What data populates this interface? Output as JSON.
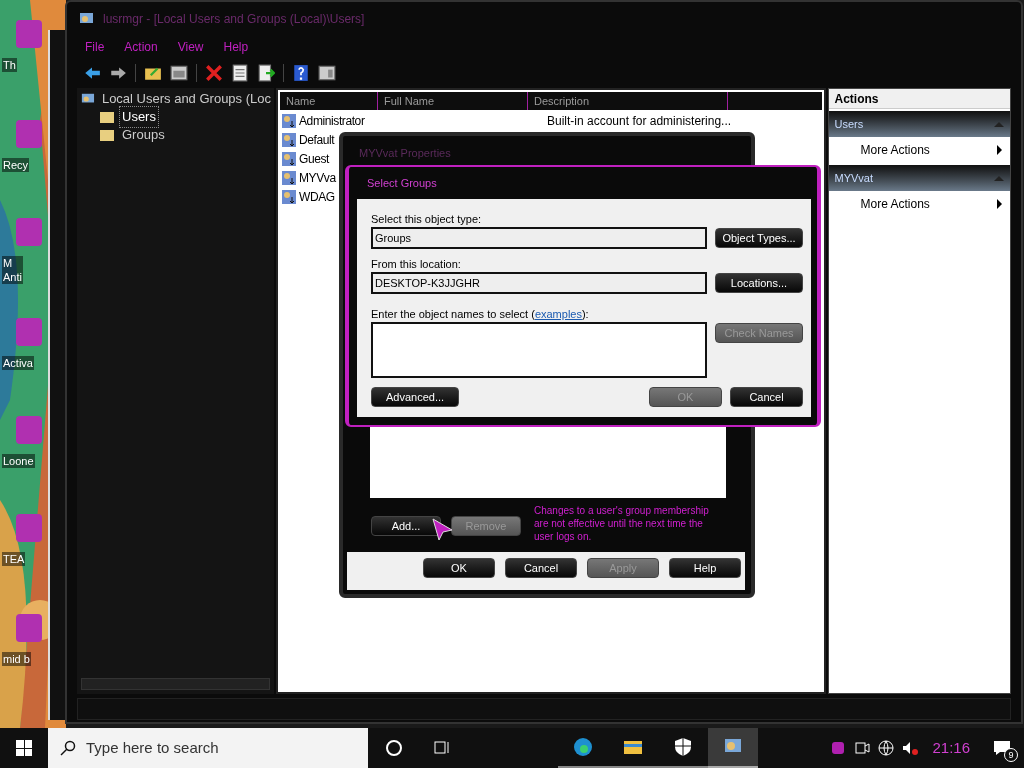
{
  "desktop_icons": [
    {
      "label": "Th"
    },
    {
      "label": "Recy"
    },
    {
      "label": "M\nAnti"
    },
    {
      "label": "Activa"
    },
    {
      "label": "Loone"
    },
    {
      "label": "TEA"
    },
    {
      "label": "mid b"
    }
  ],
  "window": {
    "title": "lusrmgr - [Local Users and Groups (Local)\\Users]"
  },
  "menu": [
    "File",
    "Action",
    "View",
    "Help"
  ],
  "tree": [
    {
      "label": "Local Users and Groups (Loc",
      "selected": false,
      "children": [
        {
          "label": "Users",
          "selected": true
        },
        {
          "label": "Groups",
          "selected": false
        }
      ]
    }
  ],
  "table": {
    "columns": [
      "Name",
      "Full Name",
      "Description"
    ],
    "rows": [
      {
        "name": "Administrator",
        "description": "Built-in account for administering..."
      },
      {
        "name": "Default"
      },
      {
        "name": "Guest"
      },
      {
        "name": "MYVva"
      },
      {
        "name": "WDAG"
      }
    ]
  },
  "actions": {
    "title": "Actions",
    "sections": [
      {
        "title": "Users",
        "items": [
          "More Actions"
        ]
      },
      {
        "title": "MYVvat",
        "items": [
          "More Actions"
        ]
      }
    ]
  },
  "properties_dialog": {
    "title": "MYVvat Properties",
    "buttons": [
      {
        "label": "Add...",
        "disabled": false
      },
      {
        "label": "Remove",
        "disabled": true
      }
    ],
    "note": "Changes to a user's group membership are not effective until the next time the user logs on.",
    "footer_buttons": [
      {
        "label": "OK",
        "disabled": false
      },
      {
        "label": "Cancel",
        "disabled": false
      },
      {
        "label": "Apply",
        "disabled": true
      },
      {
        "label": "Help",
        "disabled": false
      }
    ]
  },
  "select_dialog": {
    "title": "Select Groups",
    "object_type_label": "Select this object type:",
    "object_type": "Groups",
    "object_types_button": "Object Types...",
    "location_label": "From this location:",
    "location": "DESKTOP-K3JJGHR",
    "locations_button": "Locations...",
    "names_label_before": "Enter the object names to select (",
    "names_link": "examples",
    "names_label_after": "):",
    "check_names": {
      "label": "Check Names",
      "disabled": true
    },
    "advanced_button": "Advanced...",
    "buttons": [
      {
        "label": "OK",
        "disabled": true
      },
      {
        "label": "Cancel",
        "disabled": false
      }
    ]
  },
  "taskbar": {
    "search_placeholder": "Type here to search",
    "clock": "21:16",
    "notification_count": "9"
  }
}
